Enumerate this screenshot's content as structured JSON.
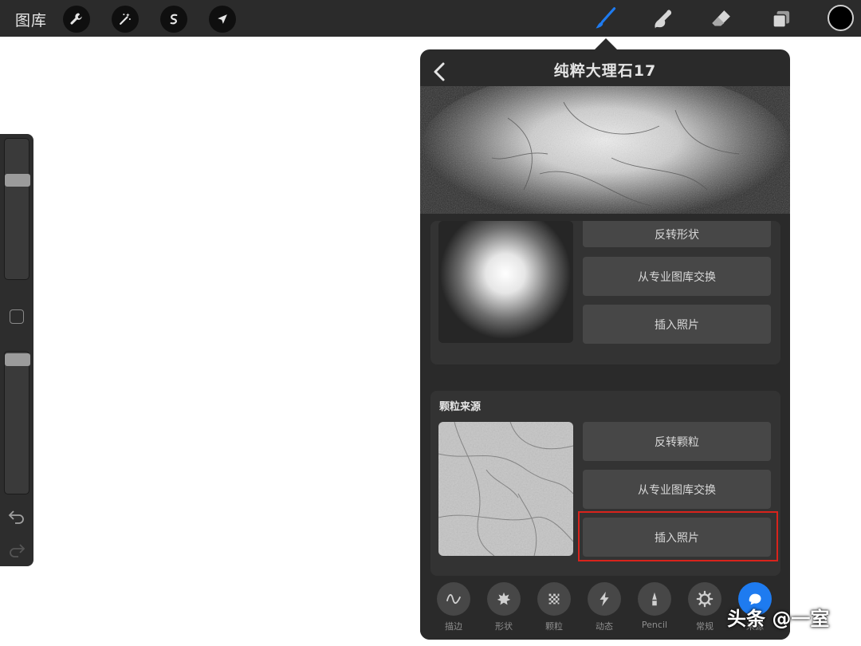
{
  "toolbar": {
    "gallery_label": "图库",
    "tools": [
      "wrench-icon",
      "magic-wand-icon",
      "selection-icon",
      "transform-arrow-icon"
    ],
    "right_tools": [
      "brush-icon",
      "smudge-icon",
      "eraser-icon",
      "layers-icon"
    ],
    "active_tool": "brush",
    "accent_color": "#1e7bf0",
    "current_color": "#000000"
  },
  "sidebar": {
    "size_slider": 0.25,
    "opacity_slider": 0.05
  },
  "brush_studio": {
    "title": "纯粹大理石17",
    "shape_source": {
      "buttons": [
        "反转形状",
        "从专业图库交换",
        "插入照片"
      ]
    },
    "grain_source": {
      "title": "颗粒来源",
      "buttons": [
        "反转颗粒",
        "从专业图库交换",
        "插入照片"
      ],
      "highlighted_button": "插入照片"
    },
    "tabs": [
      {
        "label": "描边",
        "icon": "stroke-wave-icon"
      },
      {
        "label": "形状",
        "icon": "shape-star-icon"
      },
      {
        "label": "颗粒",
        "icon": "grain-checker-icon"
      },
      {
        "label": "动态",
        "icon": "lightning-icon"
      },
      {
        "label": "Pencil",
        "icon": "pencil-tip-icon"
      },
      {
        "label": "常规",
        "icon": "gear-icon"
      },
      {
        "label": "来源",
        "icon": "source-icon"
      }
    ],
    "active_tab": "来源"
  },
  "watermark": "头条 @一室"
}
